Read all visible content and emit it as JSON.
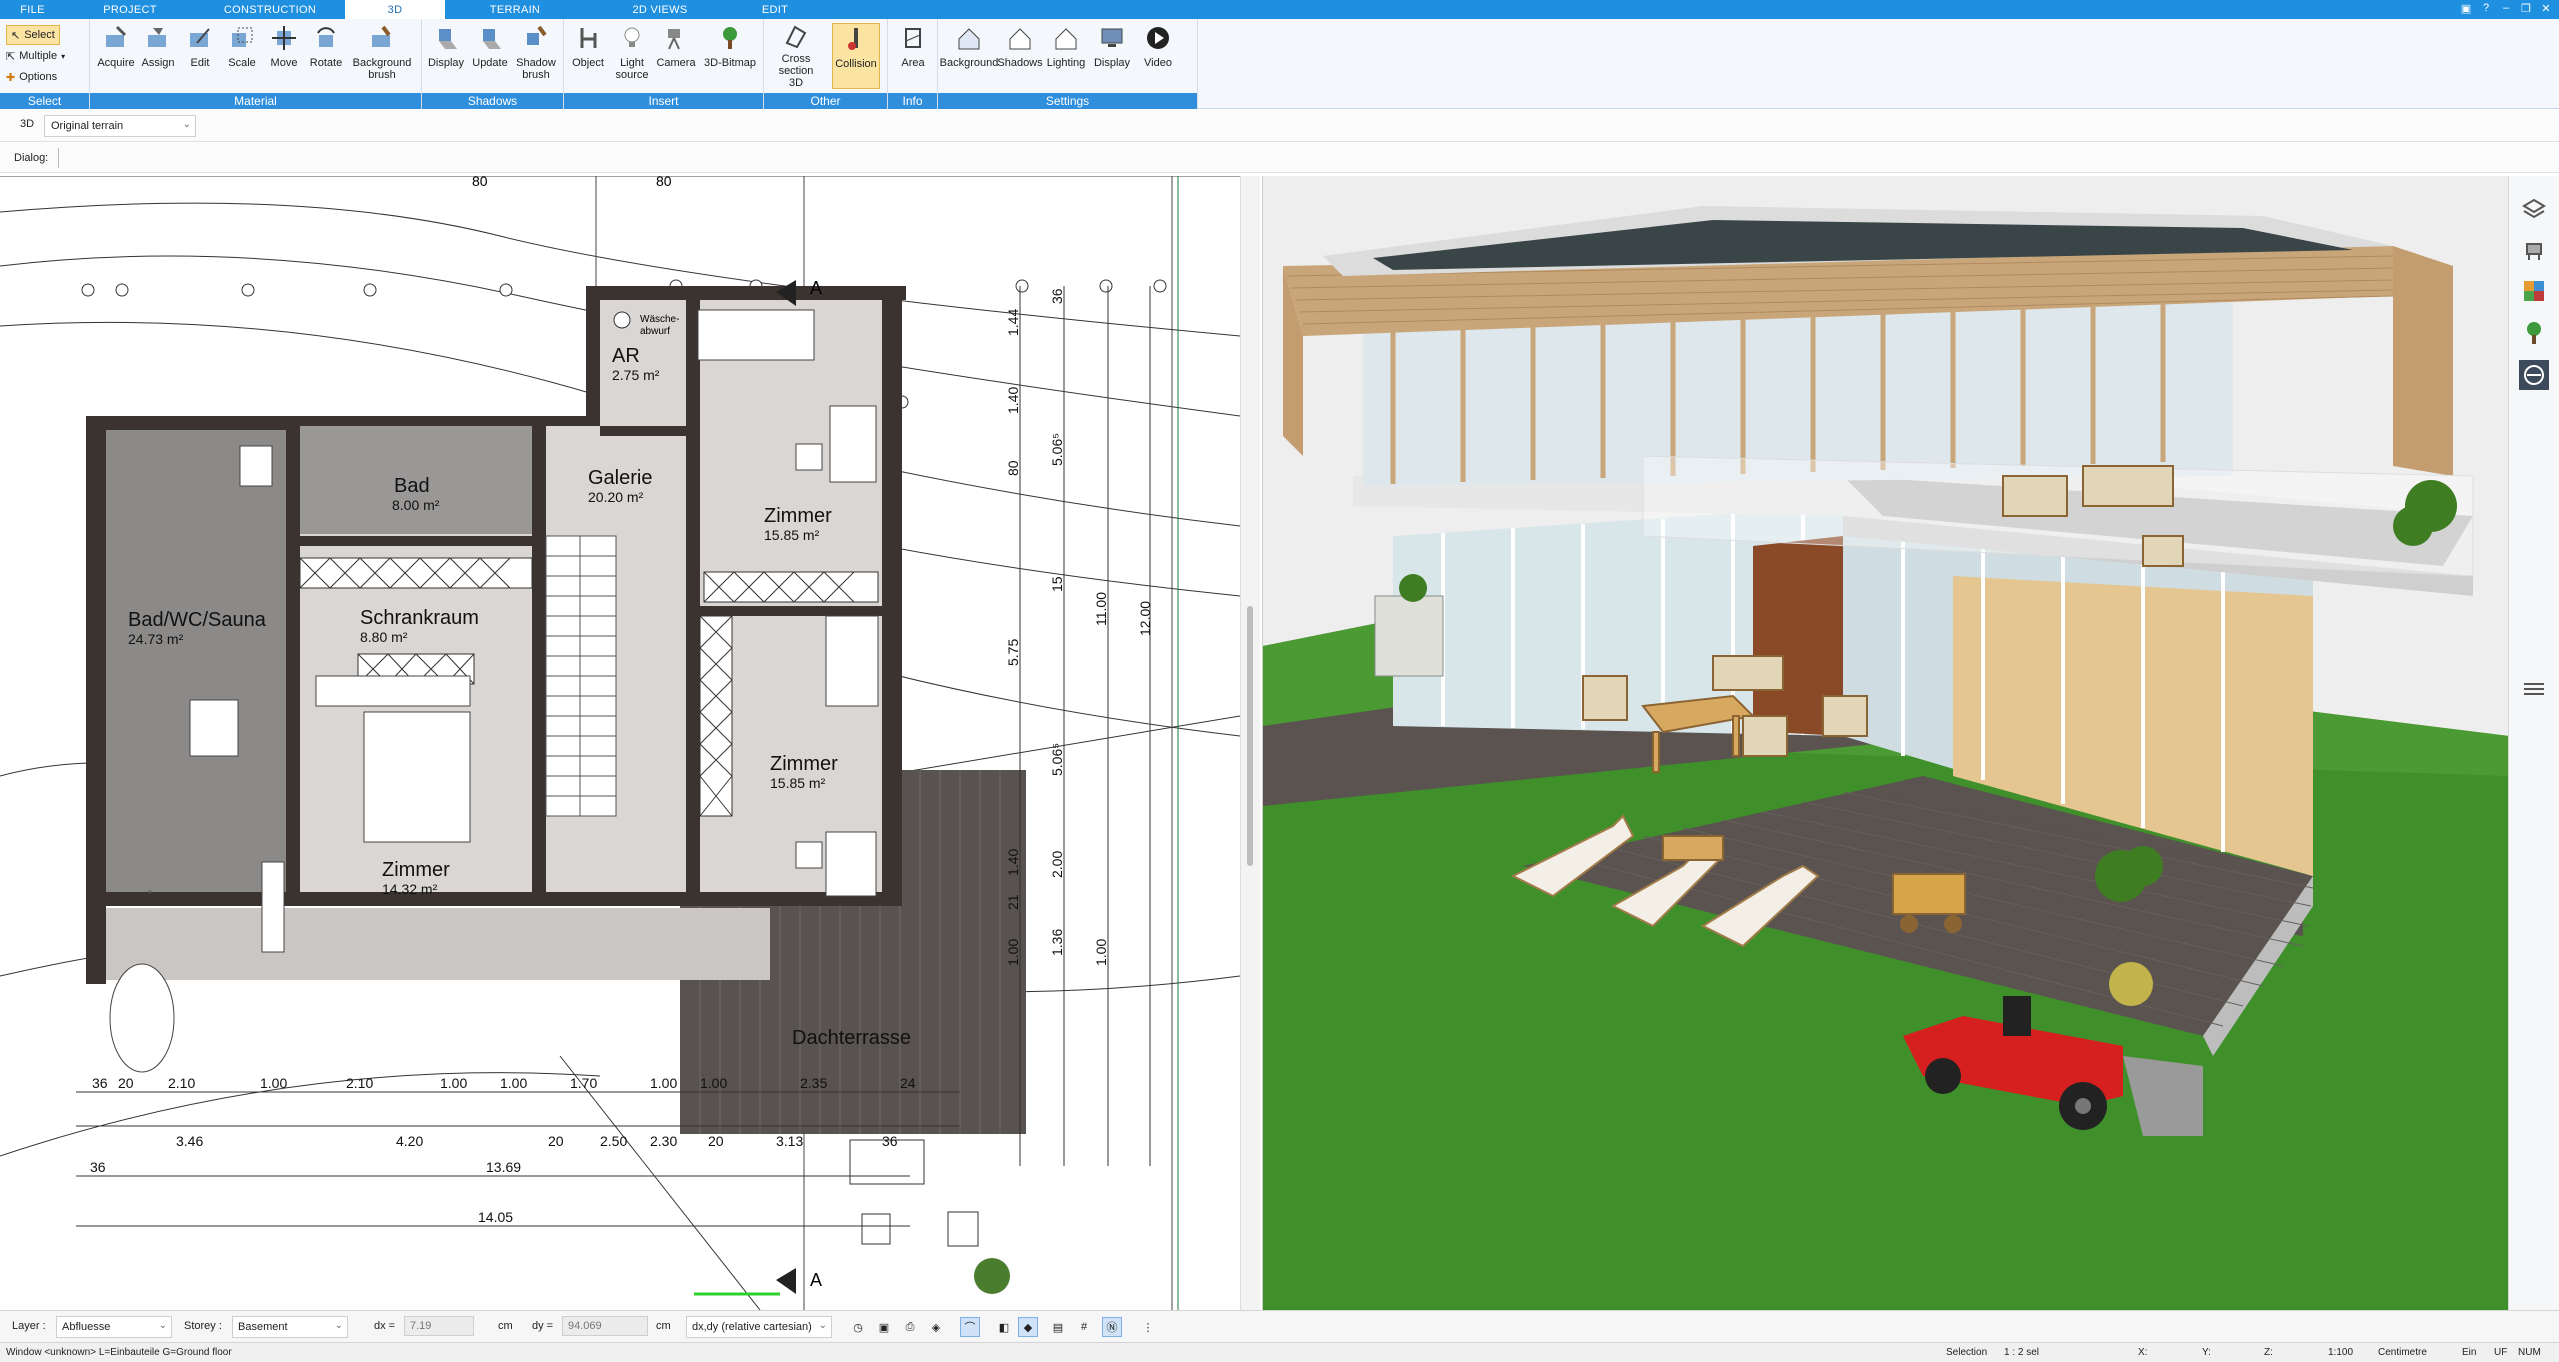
{
  "menu": {
    "tabs": [
      "FILE",
      "PROJECT",
      "CONSTRUCTION",
      "3D",
      "TERRAIN",
      "2D VIEWS",
      "EDIT"
    ],
    "active": "3D"
  },
  "ribbon": {
    "select_group": {
      "title": "Select",
      "items": [
        "Select",
        "Multiple",
        "Options"
      ]
    },
    "material_group": {
      "title": "Material",
      "buttons": [
        "Acquire",
        "Assign",
        "Edit",
        "Scale",
        "Move",
        "Rotate",
        "Background brush"
      ]
    },
    "shadows_group": {
      "title": "Shadows",
      "buttons": [
        "Display",
        "Update",
        "Shadow brush"
      ]
    },
    "insert_group": {
      "title": "Insert",
      "buttons": [
        "Object",
        "Light source",
        "Camera",
        "3D-Bitmap"
      ]
    },
    "other_group": {
      "title": "Other",
      "buttons": [
        "Cross section 3D",
        "Collision"
      ]
    },
    "info_group": {
      "title": "Info",
      "buttons": [
        "Area"
      ]
    },
    "settings_group": {
      "title": "Settings",
      "buttons": [
        "Background",
        "Shadows",
        "Lighting",
        "Display",
        "Video"
      ]
    }
  },
  "subbar": {
    "mode": "3D",
    "terrain": "Original terrain",
    "dialog_label": "Dialog:"
  },
  "plan": {
    "rooms": [
      {
        "name": "AR",
        "area": "2.75 m²"
      },
      {
        "name": "Bad",
        "area": "8.00 m²"
      },
      {
        "name": "Galerie",
        "area": "20.20 m²"
      },
      {
        "name": "Zimmer",
        "area": "15.85 m²"
      },
      {
        "name": "Bad/WC/Sauna",
        "area": "24.73 m²"
      },
      {
        "name": "Schrankraum",
        "area": "8.80 m²"
      },
      {
        "name": "Zimmer",
        "area": "15.85 m²"
      },
      {
        "name": "Zimmer",
        "area": "14.32 m²"
      },
      {
        "name": "Dachterrasse",
        "area": ""
      }
    ],
    "waesche_label": [
      "Wäsche-",
      "abwurf"
    ],
    "top_dims": [
      "80",
      "80"
    ],
    "right_dims": [
      "36",
      "1.44",
      "1.40",
      "80",
      "5.06⁵",
      "15",
      "11.00",
      "12.00",
      "5.75",
      "5.06⁵",
      "1.40",
      "2.00",
      "21",
      "1.36",
      "1.00",
      "1.00"
    ],
    "bottom_dims_row1": [
      "36",
      "20",
      "2.10",
      "1.00",
      "2.10",
      "1.00",
      "1.00",
      "1.70",
      "1.00",
      "1.00",
      "2.35",
      "24"
    ],
    "bottom_dims_row2": [
      "3.46",
      "4.20",
      "20",
      "2.50",
      "2.30",
      "20",
      "3.13",
      "36"
    ],
    "bottom_dims_row3": [
      "36",
      "13.69"
    ],
    "bottom_dims_row4": [
      "14.05"
    ],
    "section_marker": "A"
  },
  "bottom_toolbar": {
    "layer_label": "Layer :",
    "layer_value": "Abfluesse",
    "storey_label": "Storey :",
    "storey_value": "Basement",
    "dx_label": "dx =",
    "dx_value": "7.19",
    "dx_unit": "cm",
    "dy_label": "dy =",
    "dy_value": "94.069",
    "dy_unit": "cm",
    "coord_mode": "dx,dy (relative cartesian)"
  },
  "statusbar": {
    "left": "Window <unknown> L=Einbauteile G=Ground floor",
    "selection": "Selection",
    "sel_count": "1 : 2 sel",
    "x": "X:",
    "y": "Y:",
    "z": "Z:",
    "scale": "1:100",
    "unit": "Centimetre",
    "ein": "Ein",
    "uf": "UF",
    "num": "NUM"
  },
  "colors": {
    "accent": "#1f8fe0",
    "ribbon_title": "#2f8fdd",
    "active_button": "#fbe3a2",
    "lawn": "#3f8f2a",
    "deck": "#5a5350",
    "wall": "#3a3330",
    "mower": "#d62020"
  }
}
